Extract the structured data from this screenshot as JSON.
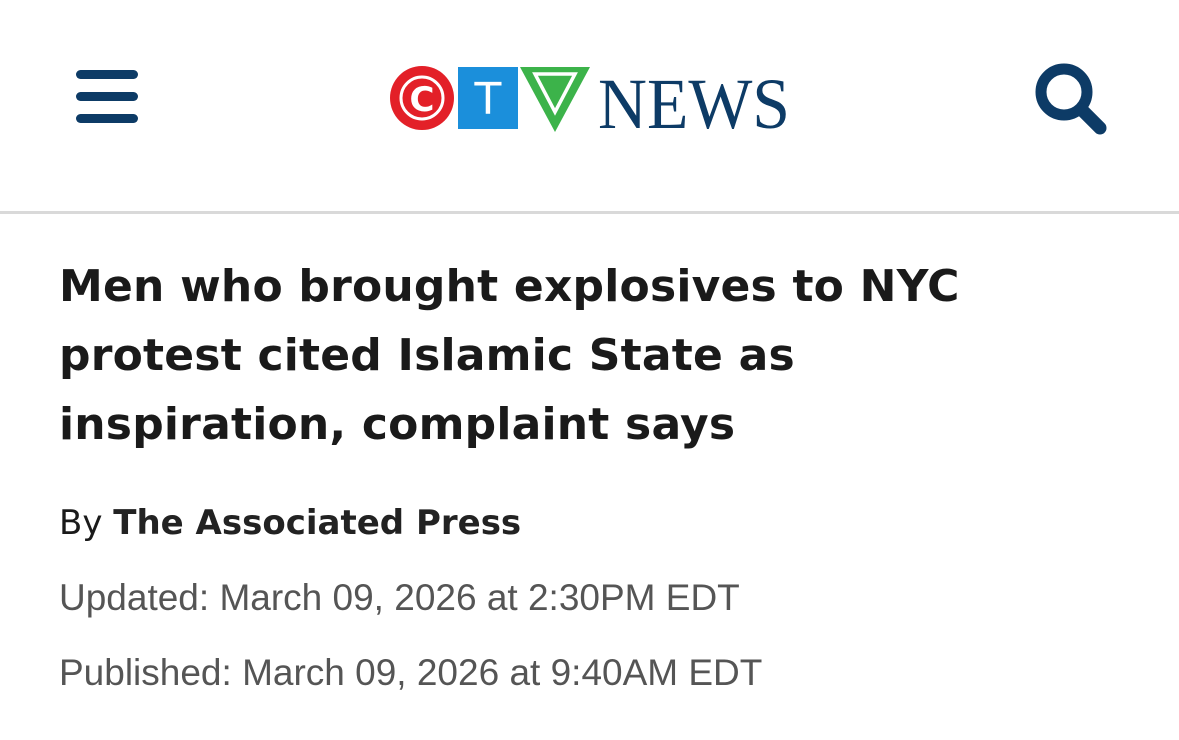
{
  "header": {
    "menu_icon": "hamburger-menu-icon",
    "logo": {
      "letters": [
        "C",
        "T",
        "V"
      ],
      "wordmark": "NEWS",
      "colors": {
        "c_circle": "#e32028",
        "t_square": "#1b8fdb",
        "v_triangle": "#3cb34a",
        "wordmark": "#0d3b66"
      }
    },
    "search_icon": "search-icon"
  },
  "article": {
    "headline_lines": [
      "Men who brought explosives to NYC",
      "protest cited Islamic State as",
      "inspiration, complaint says"
    ],
    "byline_prefix": "By",
    "author": "The Associated Press",
    "updated": "Updated: March 09, 2026 at 2:30PM EDT",
    "published": "Published: March 09, 2026 at 9:40AM EDT"
  },
  "colors": {
    "brand_navy": "#0d3b66",
    "headline_text": "#1a1a1a",
    "meta_text": "#555555",
    "divider": "#d9d9d9"
  }
}
